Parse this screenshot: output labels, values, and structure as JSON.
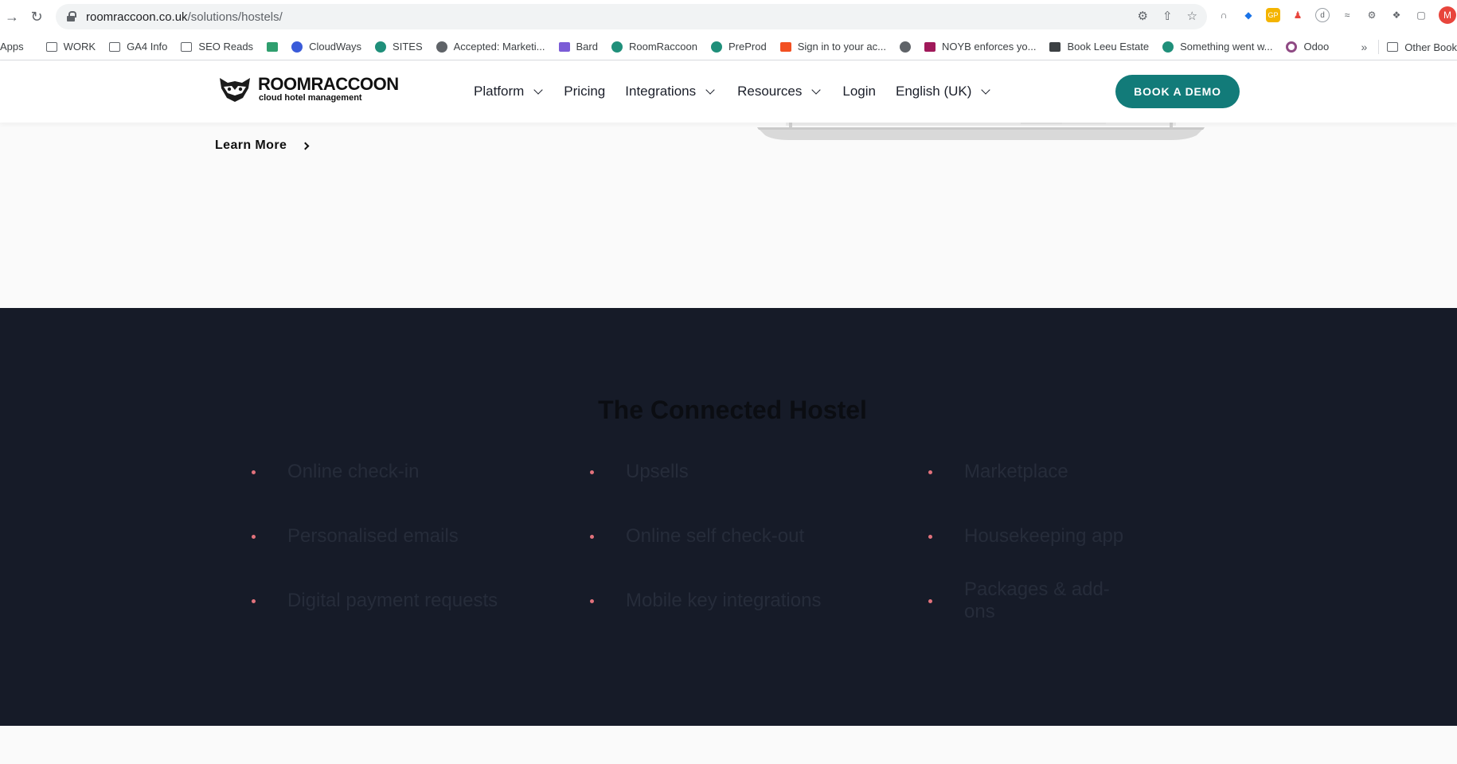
{
  "browser": {
    "url_host": "roomraccoon.co.uk",
    "url_path": "/solutions/hostels/",
    "avatar_initial": "M",
    "bookmarks": [
      {
        "label": "Apps",
        "icon": "apps-icon",
        "color": "#5f6368"
      },
      {
        "label": "WORK",
        "icon": "folder-icon",
        "color": "#5f6368"
      },
      {
        "label": "GA4 Info",
        "icon": "folder-icon",
        "color": "#5f6368"
      },
      {
        "label": "SEO Reads",
        "icon": "folder-icon",
        "color": "#5f6368"
      },
      {
        "label": "",
        "icon": "bookmark-color-icon",
        "color": "#2f9e6e"
      },
      {
        "label": "CloudWays",
        "icon": "cloud-icon",
        "color": "#3a5bd9"
      },
      {
        "label": "SITES",
        "icon": "roomraccoon-icon",
        "color": "#1f8f7a"
      },
      {
        "label": "Accepted: Marketi...",
        "icon": "globe-icon",
        "color": "#5f6368"
      },
      {
        "label": "Bard",
        "icon": "sparkle-icon",
        "color": "#7b5cd6"
      },
      {
        "label": "RoomRaccoon",
        "icon": "roomraccoon-icon",
        "color": "#1f8f7a"
      },
      {
        "label": "PreProd",
        "icon": "roomraccoon-icon",
        "color": "#1f8f7a"
      },
      {
        "label": "Sign in to your ac...",
        "icon": "microsoft-icon",
        "color": "#f25022"
      },
      {
        "label": "",
        "icon": "globe-icon",
        "color": "#5f6368"
      },
      {
        "label": "NOYB enforces yo...",
        "icon": "noyb-icon",
        "color": "#a0195a"
      },
      {
        "label": "Book Leeu Estate",
        "icon": "leeu-icon",
        "color": "#3c4043"
      },
      {
        "label": "Something went w...",
        "icon": "roomraccoon-icon",
        "color": "#1f8f7a"
      },
      {
        "label": "Odoo",
        "icon": "odoo-icon",
        "color": "#8f4a84"
      }
    ],
    "other_bookmarks": "Other Book"
  },
  "header": {
    "logo_name": "ROOMRACCOON",
    "logo_tagline": "cloud hotel management",
    "nav": [
      {
        "label": "Platform",
        "dropdown": true
      },
      {
        "label": "Pricing",
        "dropdown": false
      },
      {
        "label": "Integrations",
        "dropdown": true
      },
      {
        "label": "Resources",
        "dropdown": true
      },
      {
        "label": "Login",
        "dropdown": false
      },
      {
        "label": "English (UK)",
        "dropdown": true
      }
    ],
    "cta": "BOOK A DEMO"
  },
  "intro": {
    "learn_more": "Learn More"
  },
  "connected": {
    "title": "The Connected Hostel",
    "features": [
      "Online check-in",
      "Upsells",
      "Marketplace",
      "Personalised emails",
      "Online self check-out",
      "Housekeeping app",
      "Digital payment requests",
      "Mobile key integrations",
      "Packages & add-ons"
    ]
  },
  "colors": {
    "brand_teal": "#127b79",
    "dark_bg": "#161b28",
    "bullet": "#e2727c"
  }
}
